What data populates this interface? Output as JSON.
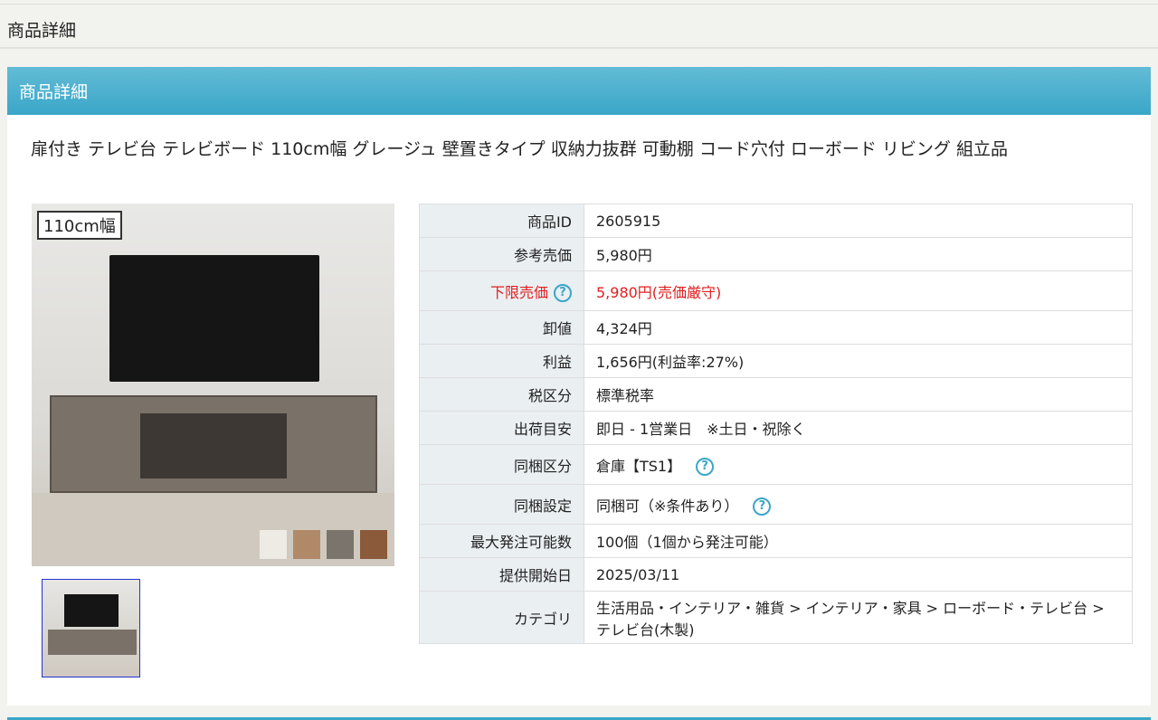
{
  "page_title": "商品詳細",
  "panel_title": "商品詳細",
  "product_name": "扉付き テレビ台 テレビボード 110cm幅 グレージュ 壁置きタイプ 収納力抜群 可動棚 コード穴付 ローボード リビング 組立品",
  "image_badge": "110cm幅",
  "colors": {
    "accent": "#3aa6c8",
    "red": "#e02020",
    "swatches": [
      "#eeeae4",
      "#b08a68",
      "#7a746c",
      "#8a5a3a"
    ]
  },
  "details": [
    {
      "label": "商品ID",
      "value": "2605915"
    },
    {
      "label": "参考売価",
      "value": "5,980円"
    },
    {
      "label": "下限売価",
      "value": "5,980円(売価厳守)",
      "help": "?"
    },
    {
      "label": "卸値",
      "value": "4,324円"
    },
    {
      "label": "利益",
      "value": "1,656円(利益率:27%)"
    },
    {
      "label": "税区分",
      "value": "標準税率"
    },
    {
      "label": "出荷目安",
      "value": "即日 - 1営業日　※土日・祝除く"
    },
    {
      "label": "同梱区分",
      "value": "倉庫【TS1】",
      "help": "?"
    },
    {
      "label": "同梱設定",
      "value": "同梱可（※条件あり）",
      "help": "?"
    },
    {
      "label": "最大発注可能数",
      "value": "100個（1個から発注可能）"
    },
    {
      "label": "提供開始日",
      "value": "2025/03/11"
    },
    {
      "label": "カテゴリ",
      "value": "生活用品・インテリア・雑貨 > インテリア・家具 > ローボード・テレビ台 > テレビ台(木製)"
    }
  ]
}
